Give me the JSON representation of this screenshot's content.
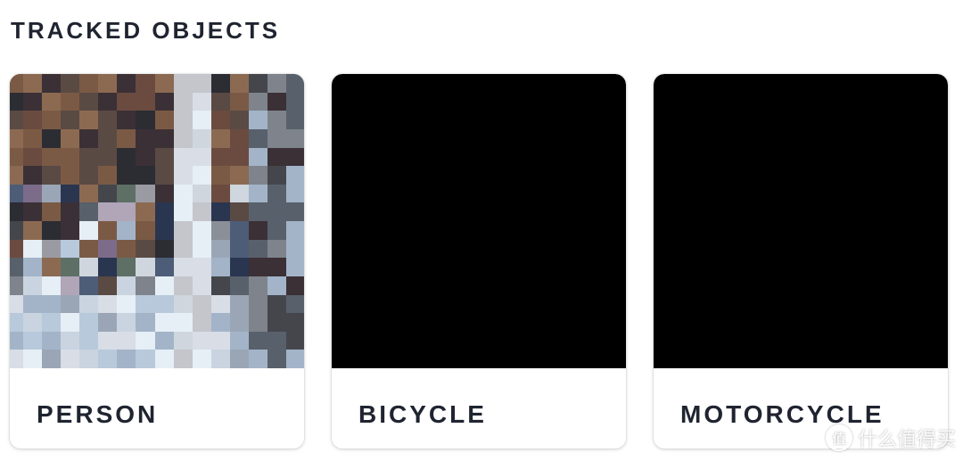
{
  "section": {
    "title": "TRACKED OBJECTS"
  },
  "cards": [
    {
      "label": "PERSON",
      "thumbnail": "pixelated-person-snapshot"
    },
    {
      "label": "BICYCLE",
      "thumbnail": "black-empty-snapshot"
    },
    {
      "label": "MOTORCYCLE",
      "thumbnail": "black-empty-snapshot"
    }
  ],
  "watermark": {
    "icon_glyph": "值",
    "text": "什么值得买"
  },
  "colors": {
    "text": "#1f2430",
    "card_bg": "#ffffff",
    "thumb_empty": "#000000"
  }
}
